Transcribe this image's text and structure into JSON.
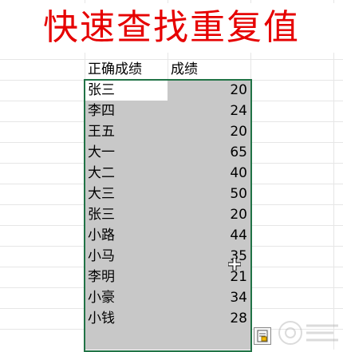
{
  "title": "快速查找重复值",
  "headers": {
    "col1": "正确成绩",
    "col2": "成绩"
  },
  "rows": [
    {
      "name": "张三",
      "score": "20"
    },
    {
      "name": "李四",
      "score": "24"
    },
    {
      "name": "王五",
      "score": "20"
    },
    {
      "name": "大一",
      "score": "65"
    },
    {
      "name": "大二",
      "score": "40"
    },
    {
      "name": "大三",
      "score": "50"
    },
    {
      "name": "张三",
      "score": "20"
    },
    {
      "name": "小路",
      "score": "44"
    },
    {
      "name": "小马",
      "score": "35"
    },
    {
      "name": "李明",
      "score": "21"
    },
    {
      "name": "小豪",
      "score": "34"
    },
    {
      "name": "小钱",
      "score": "28"
    }
  ],
  "colors": {
    "title": "#e60000",
    "selection_fill": "#c8c8c8",
    "selection_border": "#217346",
    "gridline": "#e6e6e6"
  },
  "icons": {
    "cursor": "cross-cursor-icon",
    "quick_analysis": "quick-analysis-icon",
    "watermark": "watermark-logo-icon"
  }
}
